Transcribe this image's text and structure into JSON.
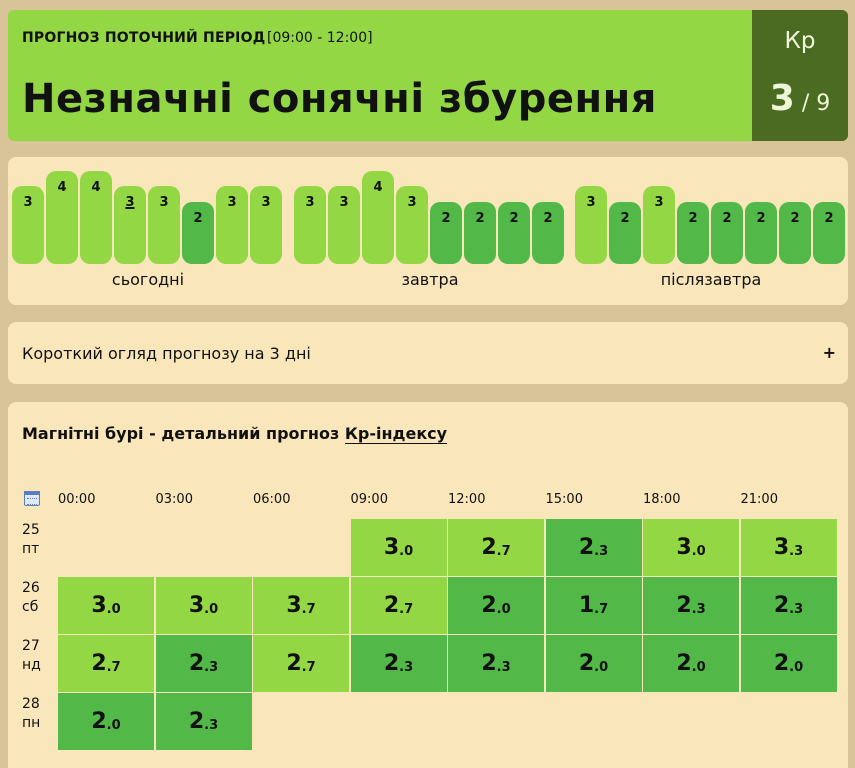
{
  "header": {
    "label": "ПРОГНОЗ ПОТОЧНИЙ ПЕРІОД",
    "period": "[09:00 - 12:00]",
    "title": "Незначні сонячні збурення",
    "kp_label": "Кр",
    "kp_value": "3",
    "kp_max": " / 9"
  },
  "bars": {
    "days": [
      "сьогодні",
      "завтра",
      "післязавтра"
    ],
    "today": [
      "3",
      "4",
      "4",
      "3",
      "3",
      "2",
      "3",
      "3"
    ],
    "tomorrow": [
      "3",
      "3",
      "4",
      "3",
      "2",
      "2",
      "2",
      "2"
    ],
    "after": [
      "3",
      "2",
      "3",
      "2",
      "2",
      "2",
      "2",
      "2"
    ],
    "current_index": 3
  },
  "summary": {
    "text": "Короткий огляд прогнозу на 3 дні",
    "toggle": "+"
  },
  "detail": {
    "title": "Магнітні бурі - детальний прогноз ",
    "title_link": "Кр-індексу",
    "hours": [
      "00:00",
      "03:00",
      "06:00",
      "09:00",
      "12:00",
      "15:00",
      "18:00",
      "21:00"
    ],
    "rows": [
      {
        "day": "25",
        "weekday": "пт",
        "start": 3,
        "values": [
          "3.0",
          "2.7",
          "2.3",
          "3.0",
          "3.3"
        ]
      },
      {
        "day": "26",
        "weekday": "сб",
        "start": 0,
        "values": [
          "3.0",
          "3.0",
          "3.7",
          "2.7",
          "2.0",
          "1.7",
          "2.3",
          "2.3"
        ]
      },
      {
        "day": "27",
        "weekday": "нд",
        "start": 0,
        "values": [
          "2.7",
          "2.3",
          "2.7",
          "2.3",
          "2.3",
          "2.0",
          "2.0",
          "2.0"
        ]
      },
      {
        "day": "28",
        "weekday": "пн",
        "start": 0,
        "values": [
          "2.0",
          "2.3"
        ]
      }
    ]
  },
  "colors": {
    "light_green": "#93d844",
    "dark_green": "#52b847",
    "kp_box": "#4c6b22",
    "panel": "#f9e6bb",
    "background": "#d9c399"
  }
}
